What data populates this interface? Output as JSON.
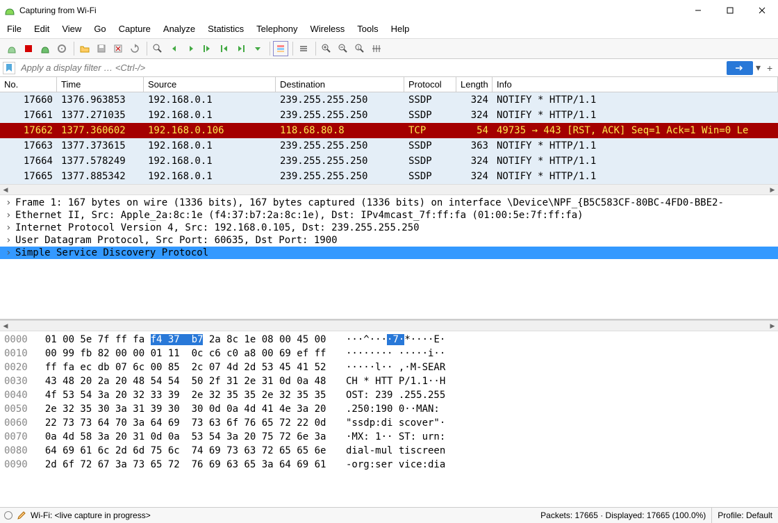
{
  "window": {
    "title": "Capturing from Wi-Fi"
  },
  "menu": [
    "File",
    "Edit",
    "View",
    "Go",
    "Capture",
    "Analyze",
    "Statistics",
    "Telephony",
    "Wireless",
    "Tools",
    "Help"
  ],
  "filter": {
    "placeholder": "Apply a display filter … <Ctrl-/>"
  },
  "columns": {
    "no": "No.",
    "time": "Time",
    "source": "Source",
    "destination": "Destination",
    "protocol": "Protocol",
    "length": "Length",
    "info": "Info"
  },
  "packets": [
    {
      "no": "17660",
      "time": "1376.963853",
      "src": "192.168.0.1",
      "dst": "239.255.255.250",
      "proto": "SSDP",
      "len": "324",
      "info": "NOTIFY * HTTP/1.1",
      "cls": "row-lightblue"
    },
    {
      "no": "17661",
      "time": "1377.271035",
      "src": "192.168.0.1",
      "dst": "239.255.255.250",
      "proto": "SSDP",
      "len": "324",
      "info": "NOTIFY * HTTP/1.1",
      "cls": "row-lightblue"
    },
    {
      "no": "17662",
      "time": "1377.360602",
      "src": "192.168.0.106",
      "dst": "118.68.80.8",
      "proto": "TCP",
      "len": "54",
      "info": "49735 → 443 [RST, ACK] Seq=1 Ack=1 Win=0 Le",
      "cls": "row-red"
    },
    {
      "no": "17663",
      "time": "1377.373615",
      "src": "192.168.0.1",
      "dst": "239.255.255.250",
      "proto": "SSDP",
      "len": "363",
      "info": "NOTIFY * HTTP/1.1",
      "cls": "row-lightblue"
    },
    {
      "no": "17664",
      "time": "1377.578249",
      "src": "192.168.0.1",
      "dst": "239.255.255.250",
      "proto": "SSDP",
      "len": "324",
      "info": "NOTIFY * HTTP/1.1",
      "cls": "row-lightblue"
    },
    {
      "no": "17665",
      "time": "1377.885342",
      "src": "192.168.0.1",
      "dst": "239.255.255.250",
      "proto": "SSDP",
      "len": "324",
      "info": "NOTIFY * HTTP/1.1",
      "cls": "row-lightblue"
    }
  ],
  "tree": [
    {
      "text": "Frame 1: 167 bytes on wire (1336 bits), 167 bytes captured (1336 bits) on interface \\Device\\NPF_{B5C583CF-80BC-4FD0-BBE2-",
      "sel": false
    },
    {
      "text": "Ethernet II, Src: Apple_2a:8c:1e (f4:37:b7:2a:8c:1e), Dst: IPv4mcast_7f:ff:fa (01:00:5e:7f:ff:fa)",
      "sel": false
    },
    {
      "text": "Internet Protocol Version 4, Src: 192.168.0.105, Dst: 239.255.255.250",
      "sel": false
    },
    {
      "text": "User Datagram Protocol, Src Port: 60635, Dst Port: 1900",
      "sel": false
    },
    {
      "text": "Simple Service Discovery Protocol",
      "sel": true
    }
  ],
  "hex": [
    {
      "off": "0000",
      "b1": "01 00 5e 7f ff fa ",
      "bh": "f4 37  b7",
      "b2": " 2a 8c 1e 08 00 45 00",
      "a1": "···^···",
      "ah": "·7·",
      "a2": "*····E·"
    },
    {
      "off": "0010",
      "b": "00 99 fb 82 00 00 01 11  0c c6 c0 a8 00 69 ef ff",
      "a": "········ ·····i··"
    },
    {
      "off": "0020",
      "b": "ff fa ec db 07 6c 00 85  2c 07 4d 2d 53 45 41 52",
      "a": "·····l·· ,·M-SEAR"
    },
    {
      "off": "0030",
      "b": "43 48 20 2a 20 48 54 54  50 2f 31 2e 31 0d 0a 48",
      "a": "CH * HTT P/1.1··H"
    },
    {
      "off": "0040",
      "b": "4f 53 54 3a 20 32 33 39  2e 32 35 35 2e 32 35 35",
      "a": "OST: 239 .255.255"
    },
    {
      "off": "0050",
      "b": "2e 32 35 30 3a 31 39 30  30 0d 0a 4d 41 4e 3a 20",
      "a": ".250:190 0··MAN: "
    },
    {
      "off": "0060",
      "b": "22 73 73 64 70 3a 64 69  73 63 6f 76 65 72 22 0d",
      "a": "\"ssdp:di scover\"·"
    },
    {
      "off": "0070",
      "b": "0a 4d 58 3a 20 31 0d 0a  53 54 3a 20 75 72 6e 3a",
      "a": "·MX: 1·· ST: urn:"
    },
    {
      "off": "0080",
      "b": "64 69 61 6c 2d 6d 75 6c  74 69 73 63 72 65 65 6e",
      "a": "dial-mul tiscreen"
    },
    {
      "off": "0090",
      "b": "2d 6f 72 67 3a 73 65 72  76 69 63 65 3a 64 69 61",
      "a": "-org:ser vice:dia"
    }
  ],
  "status": {
    "left": "Wi-Fi: <live capture in progress>",
    "packets": "Packets: 17665 · Displayed: 17665 (100.0%)",
    "profile": "Profile: Default"
  }
}
